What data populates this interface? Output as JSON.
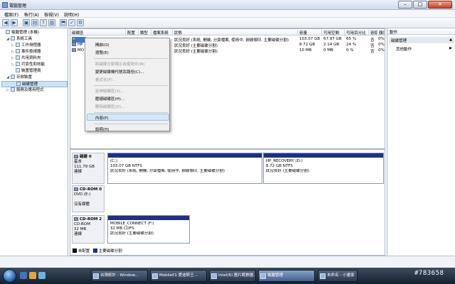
{
  "window": {
    "title": "電腦管理",
    "controls": {
      "minimize": "–",
      "maximize": "□",
      "close": "✕"
    }
  },
  "menubar": [
    "檔案(F)",
    "執行(A)",
    "檢視(V)",
    "說明(H)"
  ],
  "tree": {
    "items": [
      {
        "label": "電腦管理 (本機)",
        "level": 0,
        "expander": ""
      },
      {
        "label": "系統工具",
        "level": 1,
        "expander": "◢"
      },
      {
        "label": "工作排程器",
        "level": 2,
        "expander": "▷"
      },
      {
        "label": "事件檢視器",
        "level": 2,
        "expander": "▷"
      },
      {
        "label": "共用資料夾",
        "level": 2,
        "expander": "▷"
      },
      {
        "label": "可靠性和效能",
        "level": 2,
        "expander": "▷"
      },
      {
        "label": "裝置管理員",
        "level": 2,
        "expander": ""
      },
      {
        "label": "存放裝置",
        "level": 1,
        "expander": "◢"
      },
      {
        "label": "磁碟管理",
        "level": 2,
        "expander": "",
        "selected": true
      },
      {
        "label": "服務及應用程式",
        "level": 1,
        "expander": "▷"
      }
    ]
  },
  "volumes": {
    "columns": [
      "磁碟區",
      "配置",
      "類型",
      "檔案系統",
      "狀態",
      "容量",
      "可用空間",
      "可用百分比",
      "容錯",
      "額外負荷"
    ],
    "rows": [
      {
        "name": "",
        "layout": "",
        "type": "",
        "fs": "",
        "status": "狀況良好 (系統, 開機, 分頁檔案, 使用中, 損毀傾印, 主要磁碟分割)",
        "capacity": "103.07 GB",
        "free": "67.97 GB",
        "pct": "65 %",
        "ft": "否",
        "ov": "0%"
      },
      {
        "name": "HP",
        "layout": "",
        "type": "",
        "fs": "",
        "status": "狀況良好 (主要磁碟分割)",
        "capacity": "8.72 GB",
        "free": "2.14 GB",
        "pct": "24 %",
        "ft": "否",
        "ov": "0%"
      },
      {
        "name": "MO",
        "layout": "",
        "type": "",
        "fs": "",
        "status": "狀況良好 (主要磁碟分割)",
        "capacity": "10 MB",
        "free": "0 MB",
        "pct": "0 %",
        "ft": "否",
        "ov": "0%"
      }
    ]
  },
  "context_menu": {
    "items": [
      {
        "label": "開啟(O)",
        "enabled": true
      },
      {
        "label": "瀏覽(E)",
        "enabled": true
      },
      {
        "sep": true
      },
      {
        "label": "將磁碟分割標示為使用中(M)",
        "enabled": false
      },
      {
        "label": "變更磁碟機代號及路徑(C)...",
        "enabled": true
      },
      {
        "label": "格式化(F)...",
        "enabled": false
      },
      {
        "sep": true
      },
      {
        "label": "延伸磁碟區(X)...",
        "enabled": false
      },
      {
        "label": "壓縮磁碟區(H)...",
        "enabled": true
      },
      {
        "label": "刪除磁碟區(D)...",
        "enabled": false
      },
      {
        "sep": true
      },
      {
        "label": "內容(P)",
        "enabled": true,
        "highlighted": true
      },
      {
        "sep": true
      },
      {
        "label": "說明(H)",
        "enabled": true
      }
    ]
  },
  "disks": [
    {
      "name": "磁碟 0",
      "type": "基本",
      "size": "111.79 GB",
      "state": "連線",
      "partitions": [
        {
          "title": "(C:)",
          "size": "103.07 GB NTFS",
          "status": "狀況良好 (系統, 開機, 分頁檔案, 使用中, 損毀傾印, 主要磁碟分割)"
        },
        {
          "title": "HP_RECOVERY  (D:)",
          "size": "8.72 GB NTFS",
          "status": "狀況良好 (主要磁碟分割)"
        }
      ]
    },
    {
      "name": "CD-ROM 0",
      "type": "DVD (E:)",
      "size": "",
      "state": "沒有媒體",
      "partitions": []
    },
    {
      "name": "CD-ROM 2",
      "type": "CD-ROM",
      "size": "32 MB",
      "state": "連線",
      "partitions": [
        {
          "title": "MOBILE_CONNECT  (F:)",
          "size": "32 MB CDFS",
          "status": "狀況良好 (主要磁碟分割)"
        }
      ]
    }
  ],
  "legend": [
    {
      "label": "未配置",
      "color": "#000000"
    },
    {
      "label": "主要磁碟分割",
      "color": "#1e2f8c"
    }
  ],
  "actions": {
    "header": "動作",
    "section": "磁碟管理",
    "section_arrow": "▲",
    "more": "其他動作",
    "more_arrow": "▶"
  },
  "taskbar": {
    "tasks": [
      {
        "label": "台灣統計 - Window...",
        "active": false
      },
      {
        "label": "Mobile01 愛迪斯王...",
        "active": false
      },
      {
        "label": "Intel(R) 圖片範數圖...",
        "active": false
      },
      {
        "label": "電腦管理",
        "active": true
      },
      {
        "label": "未命名 - 小畫家",
        "active": false
      }
    ],
    "watermark": "#783658"
  },
  "colors": {
    "primary_partition": "#1e2f8c",
    "selection": "#cde1f7"
  }
}
